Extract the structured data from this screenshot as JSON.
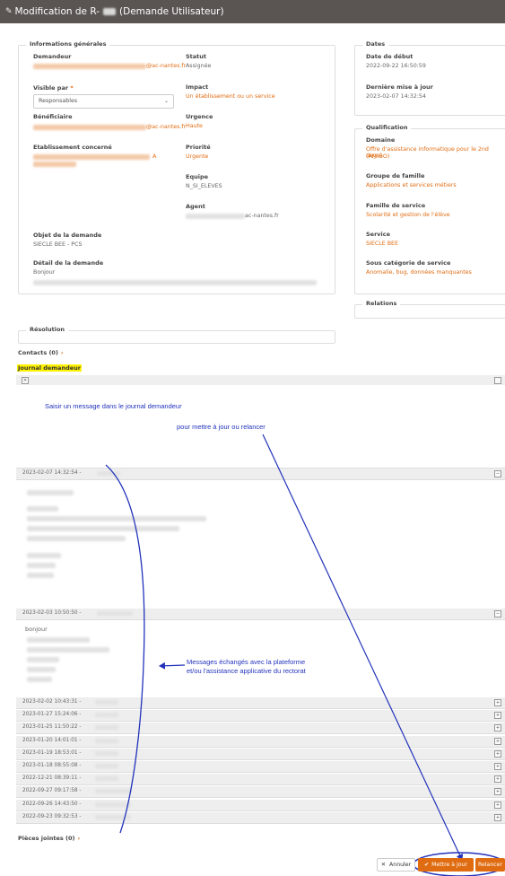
{
  "window": {
    "title_prefix": "Modification de R-",
    "title_suffix": "(Demande Utilisateur)"
  },
  "general": {
    "legend": "Informations générales",
    "demandeur_label": "Demandeur",
    "demandeur_domain": "@ac-nantes.fr",
    "visible_label": "Visible par",
    "required_mark": "*",
    "visible_value": "Responsables",
    "beneficiaire_label": "Bénéficiaire",
    "beneficiaire_domain": "@ac-nantes.fr",
    "etab_label": "Etablissement concerné",
    "etab_suffix": "A",
    "statut_label": "Statut",
    "statut_value": "Assignée",
    "impact_label": "Impact",
    "impact_value": "Un établissement ou un service",
    "urgence_label": "Urgence",
    "urgence_value": "Haute",
    "priorite_label": "Priorité",
    "priorite_value": "Urgente",
    "equipe_label": "Equipe",
    "equipe_value": "N_SI_ELEVES",
    "agent_label": "Agent",
    "agent_domain": "ac-nantes.fr",
    "objet_label": "Objet de la demande",
    "objet_value": "SIECLE BEE - PCS",
    "detail_label": "Détail de la demande",
    "detail_value": "Bonjour"
  },
  "dates": {
    "legend": "Dates",
    "debut_label": "Date de début",
    "debut_value": "2022-09-22 16:50:59",
    "maj_label": "Dernière mise à jour",
    "maj_value": "2023-02-07 14:32:54"
  },
  "qualification": {
    "legend": "Qualification",
    "domaine_label": "Domaine",
    "domaine_value_1": "Offre d'assistance informatique pour le 2nd degré",
    "domaine_value_2": "(AMIGO)",
    "groupe_label": "Groupe de famille",
    "groupe_value": "Applications et services métiers",
    "famille_label": "Famille de service",
    "famille_value": "Scolarité et gestion de l'élève",
    "service_label": "Service",
    "service_value": "SIECLE BEE",
    "souscat_label": "Sous catégorie de service",
    "souscat_value": "Anomalie, bug, données manquantes"
  },
  "relations": {
    "legend": "Relations"
  },
  "resolution": {
    "legend": "Résolution"
  },
  "contacts": {
    "label": "Contacts (0)",
    "arrow": "›"
  },
  "journal": {
    "label": "Journal demandeur",
    "close_icon": "✕",
    "first_date": "2023-02-07 14:32:54 -",
    "second_date": "2023-02-03 10:50:50 -",
    "second_body": "bonjour",
    "collapsed": [
      "2023-02-02 10:43:31 -",
      "2023-01-27 15:24:06 -",
      "2023-01-25 11:50:22 -",
      "2023-01-20 14:01:01 -",
      "2023-01-19 18:53:01 -",
      "2023-01-18 08:55:08 -",
      "2022-12-21 08:39:11 -",
      "2022-09-27 09:17:58 -",
      "2022-09-26 14:43:50 -",
      "2022-09-23 09:32:53 -"
    ]
  },
  "pieces": {
    "label": "Pièces jointes (0)",
    "arrow": "›"
  },
  "annotations": {
    "saisir": "Saisir un message dans le journal demandeur",
    "pour": "pour mettre à jour ou relancer",
    "messages_1": "Messages échangés avec la plateforme",
    "messages_2": "et/ou l'assistance applicative du rectorat"
  },
  "buttons": {
    "annuler": "Annuler",
    "mettre": "Mettre à jour",
    "relancer": "Relancer"
  },
  "colors": {
    "accent": "#e06c12",
    "titlebar": "#5a5552",
    "annotation": "#2233bb",
    "highlight": "#fff200"
  }
}
